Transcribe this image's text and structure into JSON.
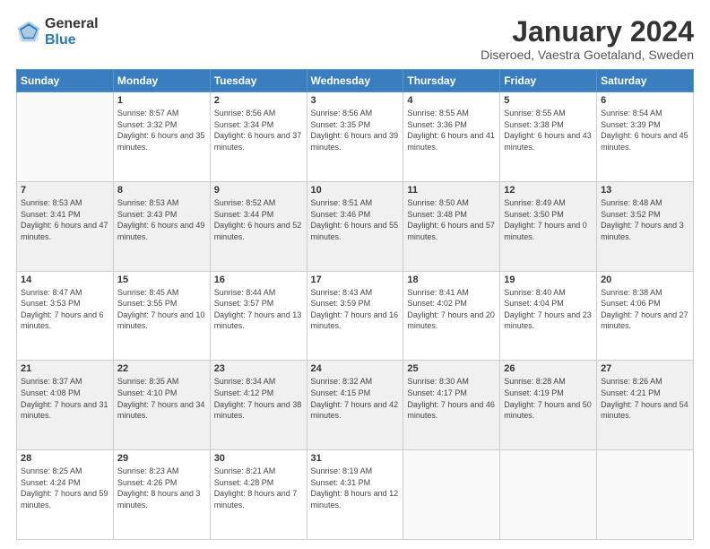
{
  "logo": {
    "general": "General",
    "blue": "Blue"
  },
  "header": {
    "month": "January 2024",
    "location": "Diseroed, Vaestra Goetaland, Sweden"
  },
  "weekdays": [
    "Sunday",
    "Monday",
    "Tuesday",
    "Wednesday",
    "Thursday",
    "Friday",
    "Saturday"
  ],
  "weeks": [
    [
      {
        "day": "",
        "sunrise": "",
        "sunset": "",
        "daylight": ""
      },
      {
        "day": "1",
        "sunrise": "Sunrise: 8:57 AM",
        "sunset": "Sunset: 3:32 PM",
        "daylight": "Daylight: 6 hours and 35 minutes."
      },
      {
        "day": "2",
        "sunrise": "Sunrise: 8:56 AM",
        "sunset": "Sunset: 3:34 PM",
        "daylight": "Daylight: 6 hours and 37 minutes."
      },
      {
        "day": "3",
        "sunrise": "Sunrise: 8:56 AM",
        "sunset": "Sunset: 3:35 PM",
        "daylight": "Daylight: 6 hours and 39 minutes."
      },
      {
        "day": "4",
        "sunrise": "Sunrise: 8:55 AM",
        "sunset": "Sunset: 3:36 PM",
        "daylight": "Daylight: 6 hours and 41 minutes."
      },
      {
        "day": "5",
        "sunrise": "Sunrise: 8:55 AM",
        "sunset": "Sunset: 3:38 PM",
        "daylight": "Daylight: 6 hours and 43 minutes."
      },
      {
        "day": "6",
        "sunrise": "Sunrise: 8:54 AM",
        "sunset": "Sunset: 3:39 PM",
        "daylight": "Daylight: 6 hours and 45 minutes."
      }
    ],
    [
      {
        "day": "7",
        "sunrise": "Sunrise: 8:53 AM",
        "sunset": "Sunset: 3:41 PM",
        "daylight": "Daylight: 6 hours and 47 minutes."
      },
      {
        "day": "8",
        "sunrise": "Sunrise: 8:53 AM",
        "sunset": "Sunset: 3:43 PM",
        "daylight": "Daylight: 6 hours and 49 minutes."
      },
      {
        "day": "9",
        "sunrise": "Sunrise: 8:52 AM",
        "sunset": "Sunset: 3:44 PM",
        "daylight": "Daylight: 6 hours and 52 minutes."
      },
      {
        "day": "10",
        "sunrise": "Sunrise: 8:51 AM",
        "sunset": "Sunset: 3:46 PM",
        "daylight": "Daylight: 6 hours and 55 minutes."
      },
      {
        "day": "11",
        "sunrise": "Sunrise: 8:50 AM",
        "sunset": "Sunset: 3:48 PM",
        "daylight": "Daylight: 6 hours and 57 minutes."
      },
      {
        "day": "12",
        "sunrise": "Sunrise: 8:49 AM",
        "sunset": "Sunset: 3:50 PM",
        "daylight": "Daylight: 7 hours and 0 minutes."
      },
      {
        "day": "13",
        "sunrise": "Sunrise: 8:48 AM",
        "sunset": "Sunset: 3:52 PM",
        "daylight": "Daylight: 7 hours and 3 minutes."
      }
    ],
    [
      {
        "day": "14",
        "sunrise": "Sunrise: 8:47 AM",
        "sunset": "Sunset: 3:53 PM",
        "daylight": "Daylight: 7 hours and 6 minutes."
      },
      {
        "day": "15",
        "sunrise": "Sunrise: 8:45 AM",
        "sunset": "Sunset: 3:55 PM",
        "daylight": "Daylight: 7 hours and 10 minutes."
      },
      {
        "day": "16",
        "sunrise": "Sunrise: 8:44 AM",
        "sunset": "Sunset: 3:57 PM",
        "daylight": "Daylight: 7 hours and 13 minutes."
      },
      {
        "day": "17",
        "sunrise": "Sunrise: 8:43 AM",
        "sunset": "Sunset: 3:59 PM",
        "daylight": "Daylight: 7 hours and 16 minutes."
      },
      {
        "day": "18",
        "sunrise": "Sunrise: 8:41 AM",
        "sunset": "Sunset: 4:02 PM",
        "daylight": "Daylight: 7 hours and 20 minutes."
      },
      {
        "day": "19",
        "sunrise": "Sunrise: 8:40 AM",
        "sunset": "Sunset: 4:04 PM",
        "daylight": "Daylight: 7 hours and 23 minutes."
      },
      {
        "day": "20",
        "sunrise": "Sunrise: 8:38 AM",
        "sunset": "Sunset: 4:06 PM",
        "daylight": "Daylight: 7 hours and 27 minutes."
      }
    ],
    [
      {
        "day": "21",
        "sunrise": "Sunrise: 8:37 AM",
        "sunset": "Sunset: 4:08 PM",
        "daylight": "Daylight: 7 hours and 31 minutes."
      },
      {
        "day": "22",
        "sunrise": "Sunrise: 8:35 AM",
        "sunset": "Sunset: 4:10 PM",
        "daylight": "Daylight: 7 hours and 34 minutes."
      },
      {
        "day": "23",
        "sunrise": "Sunrise: 8:34 AM",
        "sunset": "Sunset: 4:12 PM",
        "daylight": "Daylight: 7 hours and 38 minutes."
      },
      {
        "day": "24",
        "sunrise": "Sunrise: 8:32 AM",
        "sunset": "Sunset: 4:15 PM",
        "daylight": "Daylight: 7 hours and 42 minutes."
      },
      {
        "day": "25",
        "sunrise": "Sunrise: 8:30 AM",
        "sunset": "Sunset: 4:17 PM",
        "daylight": "Daylight: 7 hours and 46 minutes."
      },
      {
        "day": "26",
        "sunrise": "Sunrise: 8:28 AM",
        "sunset": "Sunset: 4:19 PM",
        "daylight": "Daylight: 7 hours and 50 minutes."
      },
      {
        "day": "27",
        "sunrise": "Sunrise: 8:26 AM",
        "sunset": "Sunset: 4:21 PM",
        "daylight": "Daylight: 7 hours and 54 minutes."
      }
    ],
    [
      {
        "day": "28",
        "sunrise": "Sunrise: 8:25 AM",
        "sunset": "Sunset: 4:24 PM",
        "daylight": "Daylight: 7 hours and 59 minutes."
      },
      {
        "day": "29",
        "sunrise": "Sunrise: 8:23 AM",
        "sunset": "Sunset: 4:26 PM",
        "daylight": "Daylight: 8 hours and 3 minutes."
      },
      {
        "day": "30",
        "sunrise": "Sunrise: 8:21 AM",
        "sunset": "Sunset: 4:28 PM",
        "daylight": "Daylight: 8 hours and 7 minutes."
      },
      {
        "day": "31",
        "sunrise": "Sunrise: 8:19 AM",
        "sunset": "Sunset: 4:31 PM",
        "daylight": "Daylight: 8 hours and 12 minutes."
      },
      {
        "day": "",
        "sunrise": "",
        "sunset": "",
        "daylight": ""
      },
      {
        "day": "",
        "sunrise": "",
        "sunset": "",
        "daylight": ""
      },
      {
        "day": "",
        "sunrise": "",
        "sunset": "",
        "daylight": ""
      }
    ]
  ]
}
